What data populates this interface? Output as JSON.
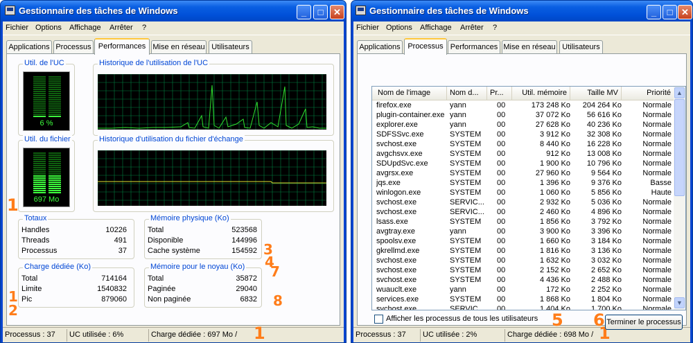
{
  "left": {
    "title": "Gestionnaire des tâches de Windows",
    "menu": [
      "Fichier",
      "Options",
      "Affichage",
      "Arrêter",
      "?"
    ],
    "tabs": [
      "Applications",
      "Processus",
      "Performances",
      "Mise en réseau",
      "Utilisateurs"
    ],
    "active_tab": "Performances",
    "cpu_usage": {
      "title": "Util. de l'UC",
      "value": "6 %",
      "level": 0.06
    },
    "cpu_history": {
      "title": "Historique de l'utilisation de l'UC"
    },
    "pf_usage": {
      "title": "Util. du fichier",
      "value": "697 Mo",
      "level": 0.45
    },
    "pf_history": {
      "title": "Historique d'utilisation du fichier d'échange"
    },
    "totaux": {
      "title": "Totaux",
      "rows": [
        {
          "label": "Handles",
          "value": "10226"
        },
        {
          "label": "Threads",
          "value": "491"
        },
        {
          "label": "Processus",
          "value": "37"
        }
      ]
    },
    "physique": {
      "title": "Mémoire physique (Ko)",
      "rows": [
        {
          "label": "Total",
          "value": "523568"
        },
        {
          "label": "Disponible",
          "value": "144996"
        },
        {
          "label": "Cache système",
          "value": "154592"
        }
      ]
    },
    "charge": {
      "title": "Charge dédiée (Ko)",
      "rows": [
        {
          "label": "Total",
          "value": "714164"
        },
        {
          "label": "Limite",
          "value": "1540832"
        },
        {
          "label": "Pic",
          "value": "879060"
        }
      ]
    },
    "noyau": {
      "title": "Mémoire pour le noyau (Ko)",
      "rows": [
        {
          "label": "Total",
          "value": "35872"
        },
        {
          "label": "Paginée",
          "value": "29040"
        },
        {
          "label": "Non paginée",
          "value": "6832"
        }
      ]
    },
    "status": {
      "processus": "Processus : 37",
      "uc": "UC utilisée : 6%",
      "charge": "Charge dédiée : 697 Mo /"
    },
    "annotations": {
      "n1": "1",
      "n1b": "1",
      "n2": "2",
      "n3": "3",
      "n4": "4",
      "n7": "7",
      "n8": "8",
      "n1c": "1"
    }
  },
  "right": {
    "title": "Gestionnaire des tâches de Windows",
    "menu": [
      "Fichier",
      "Options",
      "Affichage",
      "Arrêter",
      "?"
    ],
    "tabs": [
      "Applications",
      "Processus",
      "Performances",
      "Mise en réseau",
      "Utilisateurs"
    ],
    "active_tab": "Processus",
    "columns": [
      "Nom de l'image",
      "Nom d...",
      "Pr...",
      "Util. mémoire",
      "Taille MV",
      "Priorité"
    ],
    "rows": [
      [
        "firefox.exe",
        "yann",
        "00",
        "173 248 Ko",
        "204 264 Ko",
        "Normale"
      ],
      [
        "plugin-container.exe",
        "yann",
        "00",
        "37 072 Ko",
        "56 616 Ko",
        "Normale"
      ],
      [
        "explorer.exe",
        "yann",
        "00",
        "27 628 Ko",
        "40 236 Ko",
        "Normale"
      ],
      [
        "SDFSSvc.exe",
        "SYSTEM",
        "00",
        "3 912 Ko",
        "32 308 Ko",
        "Normale"
      ],
      [
        "svchost.exe",
        "SYSTEM",
        "00",
        "8 440 Ko",
        "16 228 Ko",
        "Normale"
      ],
      [
        "avgchsvx.exe",
        "SYSTEM",
        "00",
        "912 Ko",
        "13 008 Ko",
        "Normale"
      ],
      [
        "SDUpdSvc.exe",
        "SYSTEM",
        "00",
        "1 900 Ko",
        "10 796 Ko",
        "Normale"
      ],
      [
        "avgrsx.exe",
        "SYSTEM",
        "00",
        "27 960 Ko",
        "9 564 Ko",
        "Normale"
      ],
      [
        "jqs.exe",
        "SYSTEM",
        "00",
        "1 396 Ko",
        "9 376 Ko",
        "Basse"
      ],
      [
        "winlogon.exe",
        "SYSTEM",
        "00",
        "1 060 Ko",
        "5 856 Ko",
        "Haute"
      ],
      [
        "svchost.exe",
        "SERVIC...",
        "00",
        "2 932 Ko",
        "5 036 Ko",
        "Normale"
      ],
      [
        "svchost.exe",
        "SERVIC...",
        "00",
        "2 460 Ko",
        "4 896 Ko",
        "Normale"
      ],
      [
        "lsass.exe",
        "SYSTEM",
        "00",
        "1 856 Ko",
        "3 792 Ko",
        "Normale"
      ],
      [
        "avgtray.exe",
        "yann",
        "00",
        "3 900 Ko",
        "3 396 Ko",
        "Normale"
      ],
      [
        "spoolsv.exe",
        "SYSTEM",
        "00",
        "1 660 Ko",
        "3 184 Ko",
        "Normale"
      ],
      [
        "gkrellmd.exe",
        "SYSTEM",
        "00",
        "1 816 Ko",
        "3 136 Ko",
        "Normale"
      ],
      [
        "svchost.exe",
        "SYSTEM",
        "00",
        "1 632 Ko",
        "3 032 Ko",
        "Normale"
      ],
      [
        "svchost.exe",
        "SYSTEM",
        "00",
        "2 152 Ko",
        "2 652 Ko",
        "Normale"
      ],
      [
        "svchost.exe",
        "SYSTEM",
        "00",
        "4 436 Ko",
        "2 488 Ko",
        "Normale"
      ],
      [
        "wuauclt.exe",
        "yann",
        "00",
        "172 Ko",
        "2 252 Ko",
        "Normale"
      ],
      [
        "services.exe",
        "SYSTEM",
        "00",
        "1 868 Ko",
        "1 804 Ko",
        "Normale"
      ],
      [
        "svchost.exe",
        "SERVIC...",
        "00",
        "1 404 Ko",
        "1 700 Ko",
        "Normale"
      ]
    ],
    "show_all_label": "Afficher les processus de tous les utilisateurs",
    "end_process_label": "Terminer le processus",
    "status": {
      "processus": "Processus : 37",
      "uc": "UC utilisée : 2%",
      "charge": "Charge dédiée : 698 Mo /"
    },
    "annotations": {
      "n5": "5",
      "n6": "6",
      "n1": "1"
    }
  }
}
